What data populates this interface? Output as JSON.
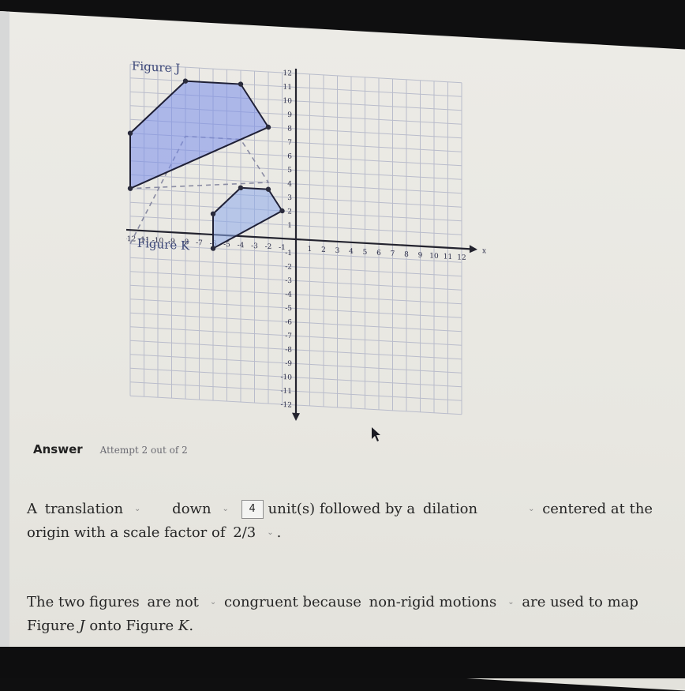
{
  "chart_data": {
    "type": "scatter",
    "title": "",
    "xlabel": "x",
    "ylabel": "",
    "xlim": [
      -12,
      12
    ],
    "ylim": [
      -12,
      12
    ],
    "grid": true,
    "x_ticks": [
      -12,
      -11,
      -10,
      -9,
      -8,
      -7,
      -6,
      -5,
      -4,
      -3,
      -2,
      -1,
      1,
      2,
      3,
      4,
      5,
      6,
      7,
      8,
      9,
      10,
      11,
      12
    ],
    "y_ticks": [
      -12,
      -11,
      -10,
      -9,
      -8,
      -7,
      -6,
      -5,
      -4,
      -3,
      -2,
      -1,
      1,
      2,
      3,
      4,
      5,
      6,
      7,
      8,
      9,
      10,
      11,
      12
    ],
    "x_tick_labels": [
      "-12",
      "-11",
      "-10",
      "-9",
      "-8",
      "-7",
      "-6",
      "-5",
      "-4",
      "-3",
      "-2",
      "-1",
      "1",
      "2",
      "3",
      "4",
      "5",
      "6",
      "7",
      "8",
      "9",
      "10",
      "11",
      "12"
    ],
    "y_tick_labels": [
      "-12",
      "-11",
      "-10",
      "-9",
      "-8",
      "-7",
      "-6",
      "-5",
      "-4",
      "-3",
      "-2",
      "-1",
      "1",
      "2",
      "3",
      "4",
      "5",
      "6",
      "7",
      "8",
      "9",
      "10",
      "11",
      "12"
    ],
    "figures": [
      {
        "name": "Figure J",
        "vertices": [
          [
            -12,
            3
          ],
          [
            -12,
            7
          ],
          [
            -8,
            11
          ],
          [
            -4,
            11
          ],
          [
            -2,
            8
          ]
        ]
      },
      {
        "name": "Figure K",
        "vertices": [
          [
            -6,
            -1
          ],
          [
            -6,
            1.5
          ],
          [
            -4,
            3.5
          ],
          [
            -2,
            3.5
          ],
          [
            -1,
            2
          ]
        ]
      }
    ],
    "guides": [
      {
        "vertices": [
          [
            -12,
            -1
          ],
          [
            -8,
            7
          ],
          [
            -4,
            7
          ],
          [
            -2,
            4
          ],
          [
            -12,
            3
          ]
        ]
      }
    ]
  },
  "answer": {
    "title": "Answer",
    "attempt": "Attempt 2 out of 2"
  },
  "sentence1": {
    "prefix": "A",
    "transform_type": "translation",
    "direction": "down",
    "units": "4",
    "mid": "unit(s) followed by a",
    "second_transform": "dilation",
    "suffix": "centered at the",
    "line2": "origin with a scale factor of",
    "scale_factor": "2/3",
    "end": "."
  },
  "sentence2": {
    "prefix": "The two figures",
    "congruence": "are not",
    "mid": "congruent because",
    "reason": "non-rigid motions",
    "suffix": "are used to map",
    "line2_a": "Figure",
    "line2_j": "J",
    "line2_b": "onto Figure",
    "line2_k": "K",
    "line2_end": "."
  }
}
